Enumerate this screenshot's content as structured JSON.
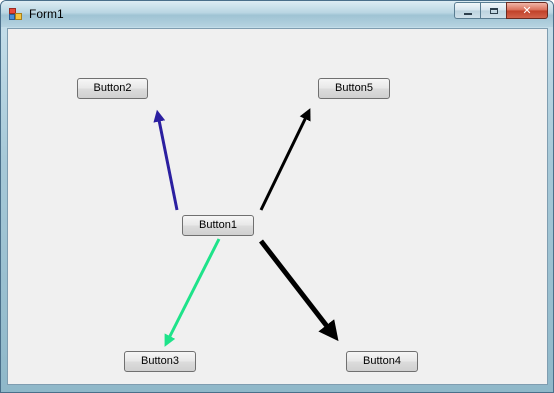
{
  "window": {
    "title": "Form1",
    "caption_buttons": {
      "minimize": "minimize",
      "maximize": "maximize",
      "close": "close"
    }
  },
  "buttons": {
    "button1": "Button1",
    "button2": "Button2",
    "button3": "Button3",
    "button4": "Button4",
    "button5": "Button5"
  },
  "arrows": [
    {
      "from": "Button1",
      "to": "Button2",
      "color": "#2b1fa0"
    },
    {
      "from": "Button1",
      "to": "Button3",
      "color": "#1ee38a"
    },
    {
      "from": "Button1",
      "to": "Button4",
      "color": "#000000"
    },
    {
      "from": "Button1",
      "to": "Button5",
      "color": "#000000"
    }
  ],
  "colors": {
    "client_background": "#f0f0f0",
    "arrow_to_button2": "#2b1fa0",
    "arrow_to_button3": "#1ee38a",
    "arrow_to_button4": "#000000",
    "arrow_to_button5": "#000000"
  }
}
